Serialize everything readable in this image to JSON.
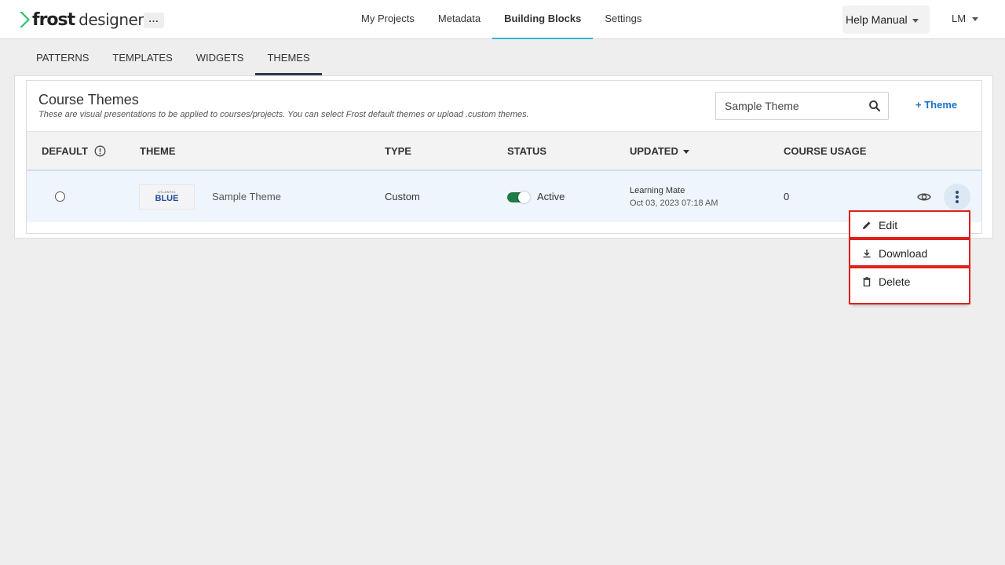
{
  "app": {
    "logo_bold": "frost",
    "logo_light": "designer",
    "more_label": "..."
  },
  "nav": {
    "items": [
      {
        "label": "My Projects"
      },
      {
        "label": "Metadata"
      },
      {
        "label": "Building Blocks",
        "active": true
      },
      {
        "label": "Settings"
      }
    ],
    "help_label": "Help Manual",
    "user_label": "LM"
  },
  "subtabs": [
    {
      "label": "PATTERNS"
    },
    {
      "label": "TEMPLATES"
    },
    {
      "label": "WIDGETS"
    },
    {
      "label": "THEMES",
      "active": true
    }
  ],
  "card": {
    "title": "Course Themes",
    "subtitle": "These are visual presentations to be applied to courses/projects. You can select Frost default themes or upload .custom themes.",
    "search_value": "Sample Theme",
    "add_label": "+ Theme"
  },
  "table": {
    "headers": {
      "default": "DEFAULT",
      "theme": "THEME",
      "type": "TYPE",
      "status": "STATUS",
      "updated": "UPDATED",
      "usage": "COURSE USAGE"
    },
    "rows": [
      {
        "thumb_small": "ATLANTIC",
        "thumb_big": "BLUE",
        "theme": "Sample Theme",
        "type": "Custom",
        "status": "Active",
        "status_on": true,
        "updated_by": "Learning Mate",
        "updated_at": "Oct 03, 2023 07:18 AM",
        "usage": "0"
      }
    ]
  },
  "menu": {
    "items": [
      {
        "label": "Edit",
        "icon": "pencil-icon"
      },
      {
        "label": "Download",
        "icon": "download-icon"
      },
      {
        "label": "Delete",
        "icon": "trash-icon"
      }
    ]
  },
  "colors": {
    "accent_tab": "#2bbbd1",
    "link": "#1a73c8",
    "toggle_on": "#1e7a46",
    "row_highlight": "#eef5fc",
    "menu_outline": "#e0201c"
  }
}
